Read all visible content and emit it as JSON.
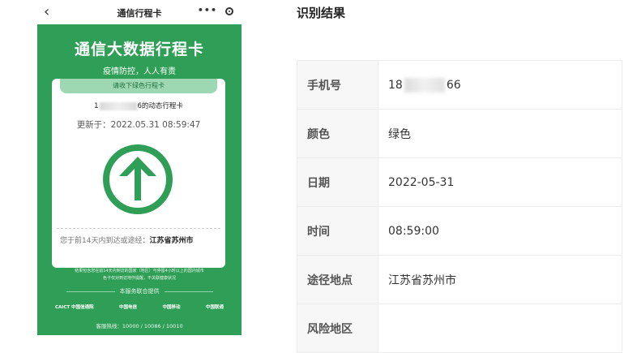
{
  "phone_app": {
    "nav_title": "通信行程卡",
    "back_icon": "chevron-left-icon",
    "more_label": "•••",
    "title": "通信大数据行程卡",
    "subtitle": "疫情防控，人人有责",
    "card": {
      "tab": "请收下绿色行程卡",
      "owner_prefix": "1",
      "owner_suffix": "6的动态行程卡",
      "updated": "更新于：2022.05.31 08:59:47",
      "status_color": "#2f9e56",
      "travel_prefix": "您于前14天内到达或途经：",
      "travel_place": "江苏省苏州市"
    },
    "notice": "结果包含您在前14天内到访的国家（地区）与停留4小时以上的国内城市\n色卡仅对到访地作提醒，不关联健康状况",
    "provider": "本服务联合提供",
    "logos": [
      "CAICT 中国信通院",
      "中国电信",
      "中国移动",
      "中国联通"
    ],
    "hotline": "客服热线：10000 / 10086 / 10010"
  },
  "result": {
    "title": "识别结果",
    "rows": [
      {
        "label": "手机号",
        "value_prefix": "18",
        "value_suffix": "66"
      },
      {
        "label": "颜色",
        "value": "绿色"
      },
      {
        "label": "日期",
        "value": "2022-05-31"
      },
      {
        "label": "时间",
        "value": "08:59:00"
      },
      {
        "label": "途径地点",
        "value": "江苏省苏州市"
      },
      {
        "label": "风险地区",
        "value": ""
      }
    ]
  }
}
